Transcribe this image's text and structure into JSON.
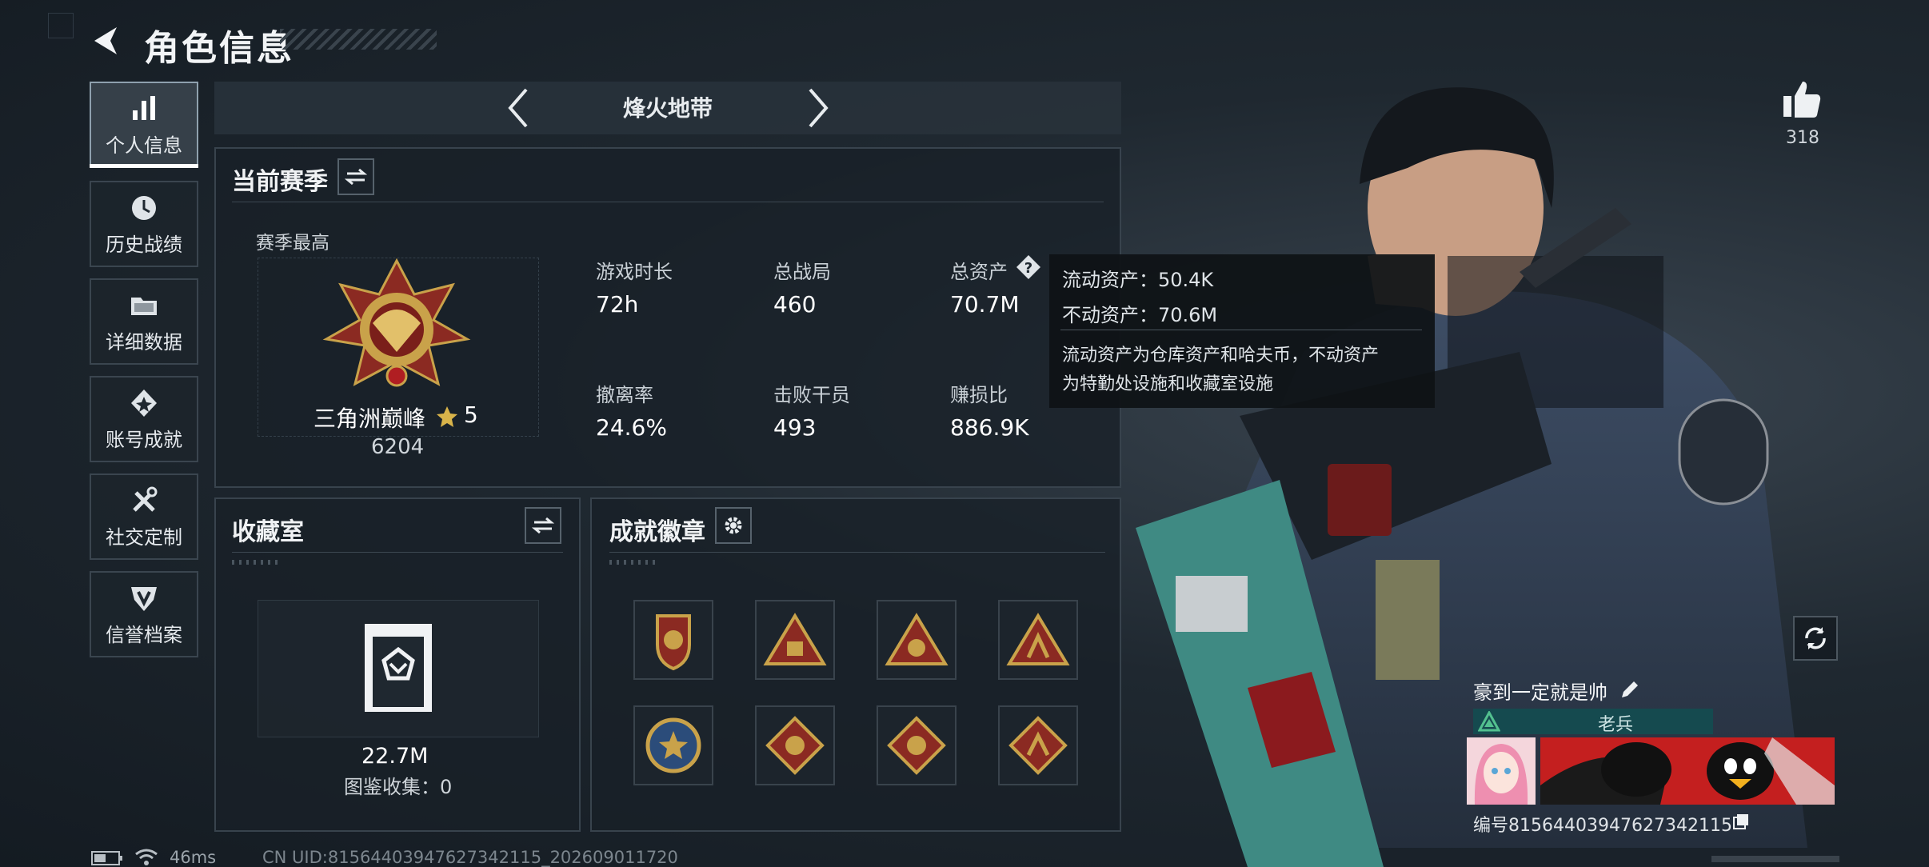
{
  "header": {
    "title": "角色信息"
  },
  "nav": [
    {
      "label": "个人信息",
      "icon": "bar-chart-icon",
      "active": true
    },
    {
      "label": "历史战绩",
      "icon": "clock-history-icon",
      "active": false
    },
    {
      "label": "详细数据",
      "icon": "folder-icon",
      "active": false
    },
    {
      "label": "账号成就",
      "icon": "achievement-icon",
      "active": false
    },
    {
      "label": "社交定制",
      "icon": "tools-icon",
      "active": false
    },
    {
      "label": "信誉档案",
      "icon": "shield-icon",
      "active": false
    }
  ],
  "mode": {
    "label": "烽火地带"
  },
  "season": {
    "title": "当前赛季",
    "best_label": "赛季最高",
    "rank_name": "三角洲巅峰",
    "rank_stars": "5",
    "rank_score": "6204",
    "stats": [
      {
        "label": "游戏时长",
        "value": "72h"
      },
      {
        "label": "总战局",
        "value": "460"
      },
      {
        "label": "总资产",
        "value": "70.7M"
      },
      {
        "label": "撤离率",
        "value": "24.6%"
      },
      {
        "label": "击败干员",
        "value": "493"
      },
      {
        "label": "赚损比",
        "value": "886.9K"
      }
    ]
  },
  "tooltip": {
    "liquid": "流动资产：50.4K",
    "fixed": "不动资产：70.6M",
    "desc_line1": "流动资产为仓库资产和哈夫币，不动资产",
    "desc_line2": "为特勤处设施和收藏室设施"
  },
  "collection": {
    "title": "收藏室",
    "value": "22.7M",
    "catalog": "图鉴收集：0"
  },
  "achievements": {
    "title": "成就徽章"
  },
  "likes": {
    "count": "318"
  },
  "profile": {
    "name": "豪到一定就是帅",
    "rank": "老兵",
    "id": "编号8156440394762734211​5"
  },
  "status": {
    "ping": "46ms",
    "uid": "CN UID:8156440394762734211​5_202609011720"
  },
  "colors": {
    "accent_teal": "#154a4f",
    "rank_gold": "#c9a24a",
    "badge_red": "#8b2a22"
  }
}
